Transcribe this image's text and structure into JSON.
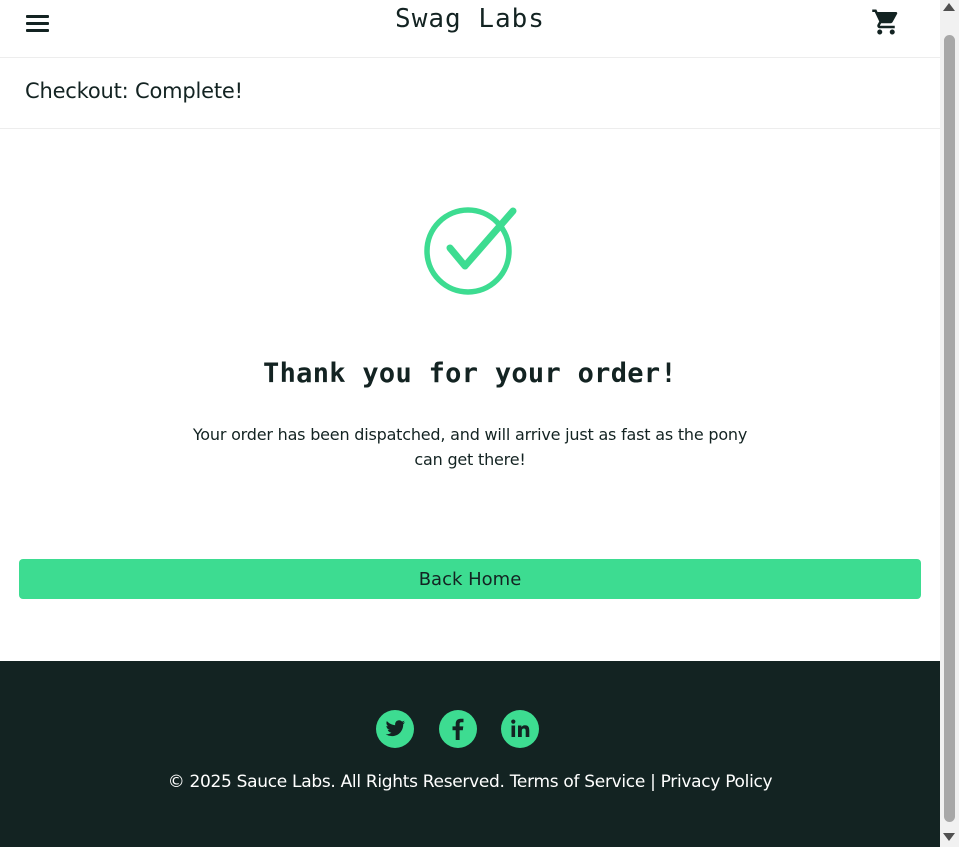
{
  "header": {
    "menu_icon": "hamburger-menu-icon",
    "app_title": "Swag Labs",
    "cart_icon": "shopping-cart-icon"
  },
  "sub_header": {
    "title": "Checkout: Complete!"
  },
  "content": {
    "status_icon": "checkmark-circle-icon",
    "heading": "Thank you for your order!",
    "message": "Your order has been dispatched, and will arrive just as fast as the pony can get there!",
    "back_button_label": "Back Home"
  },
  "footer": {
    "social_icons": [
      "twitter-icon",
      "facebook-icon",
      "linkedin-icon"
    ],
    "copyright": "© 2025 Sauce Labs. All Rights Reserved. Terms of Service | Privacy Policy"
  },
  "colors": {
    "accent": "#3ddc91",
    "text_dark": "#132322",
    "footer_bg": "#132322"
  }
}
